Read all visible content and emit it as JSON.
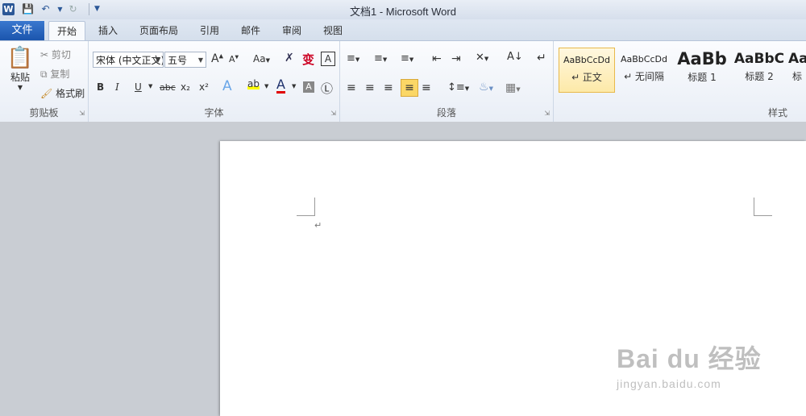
{
  "window": {
    "title": "文档1 - Microsoft Word"
  },
  "qat": {
    "app_icon": "W",
    "save_icon": "save-icon",
    "undo_icon": "undo-icon",
    "redo_icon": "redo-icon"
  },
  "tabs": [
    "开始",
    "插入",
    "页面布局",
    "引用",
    "邮件",
    "审阅",
    "视图"
  ],
  "file_tab": "文件",
  "clipboard": {
    "paste": "粘贴",
    "cut": "剪切",
    "copy": "复制",
    "format_painter": "格式刷",
    "label": "剪贴板"
  },
  "font": {
    "font_name": "宋体 (中文正文)",
    "font_size": "五号",
    "label": "字体",
    "bold": "B",
    "italic": "I",
    "underline": "U",
    "strike": "abc",
    "subscript": "x₂",
    "superscript": "x²",
    "grow": "A",
    "shrink": "A",
    "change_case": "Aa",
    "clear": "A",
    "font_color": "A"
  },
  "paragraph": {
    "label": "段落"
  },
  "styles": {
    "label": "样式",
    "items": [
      {
        "preview": "AaBbCcDd",
        "name": "↵ 正文"
      },
      {
        "preview": "AaBbCcDd",
        "name": "↵ 无间隔"
      },
      {
        "preview": "AaBb",
        "name": "标题 1"
      },
      {
        "preview": "AaBbC",
        "name": "标题 2"
      },
      {
        "preview": "Aa",
        "name": "标"
      }
    ]
  },
  "document": {
    "paragraph_mark": "↵"
  },
  "watermark": {
    "main": "Bai du 经验",
    "sub": "jingyan.baidu.com"
  },
  "colors": {
    "file_tab": "#2158b0",
    "style_selected": "#fde9a8",
    "highlight": "#ffff00",
    "font_color": "#e00000"
  }
}
